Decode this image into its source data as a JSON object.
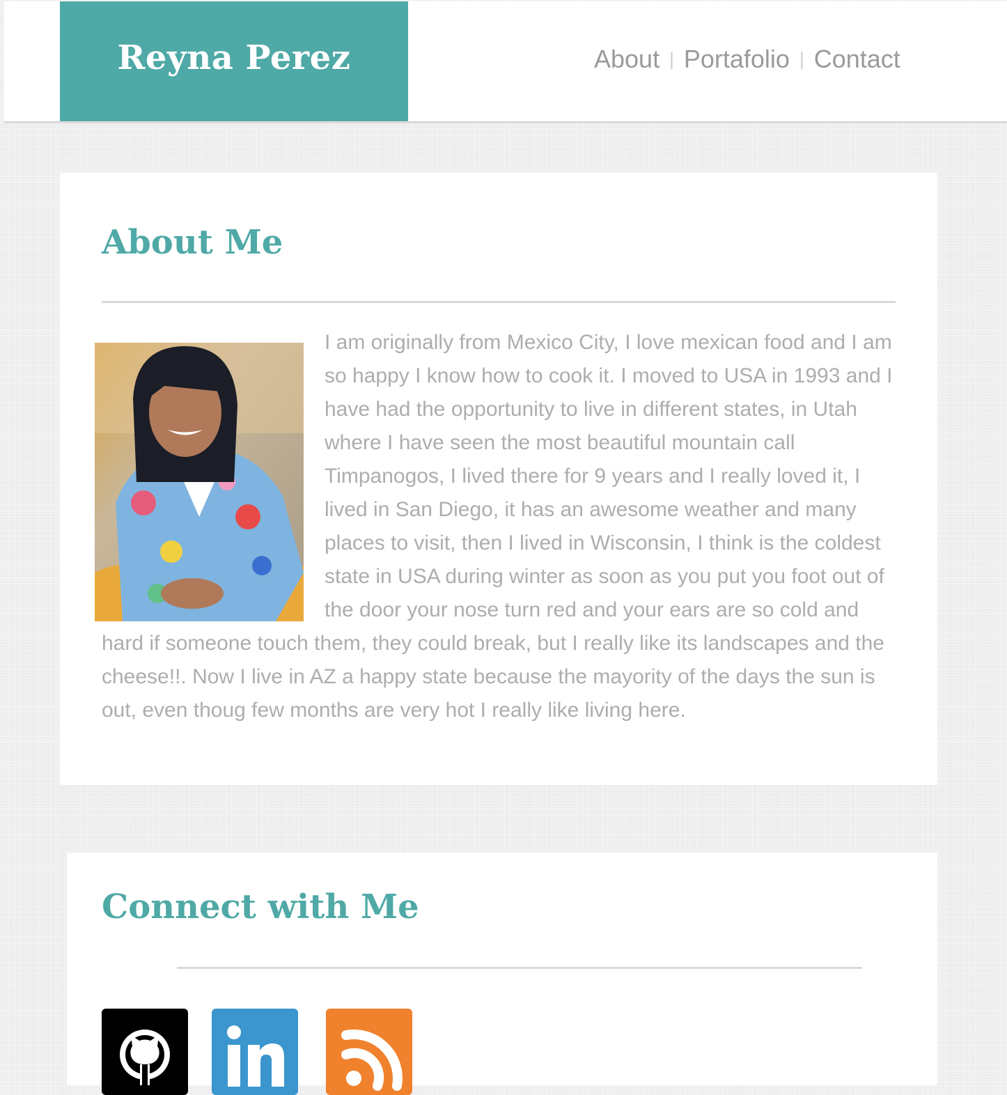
{
  "brand": {
    "name": "Reyna Perez"
  },
  "nav": {
    "items": [
      {
        "label": "About"
      },
      {
        "label": "Portafolio"
      },
      {
        "label": "Contact"
      }
    ],
    "separator": "|"
  },
  "about": {
    "title": "About Me",
    "body": "I am originally from Mexico City, I love mexican food and I am so happy I know how to cook it. I moved to USA in 1993 and I have had the opportunity to live in different states, in Utah where I have seen the most beautiful mountain call Timpanogos, I lived there for 9 years and I really loved it, I lived in San Diego, it has an awesome weather and many places to visit, then I lived in Wisconsin, I think is the coldest state in USA during winter as soon as you put you foot out of the door your nose turn red and your ears are so cold and hard if someone touch them, they could break, but I really like its landscapes and the cheese!!. Now I live in AZ a happy state because the mayority of the days the sun is out, even thoug few months are very hot I really like living here."
  },
  "connect": {
    "title": "Connect with Me",
    "icons": [
      {
        "name": "github-icon",
        "color": "#000000"
      },
      {
        "name": "linkedin-icon",
        "color": "#3a96cd"
      },
      {
        "name": "rss-icon",
        "color": "#f0822e"
      }
    ]
  },
  "colors": {
    "accent": "#4fa9a6",
    "body_text": "#adadad",
    "nav_text": "#9a9a9a",
    "background": "#ececec"
  }
}
